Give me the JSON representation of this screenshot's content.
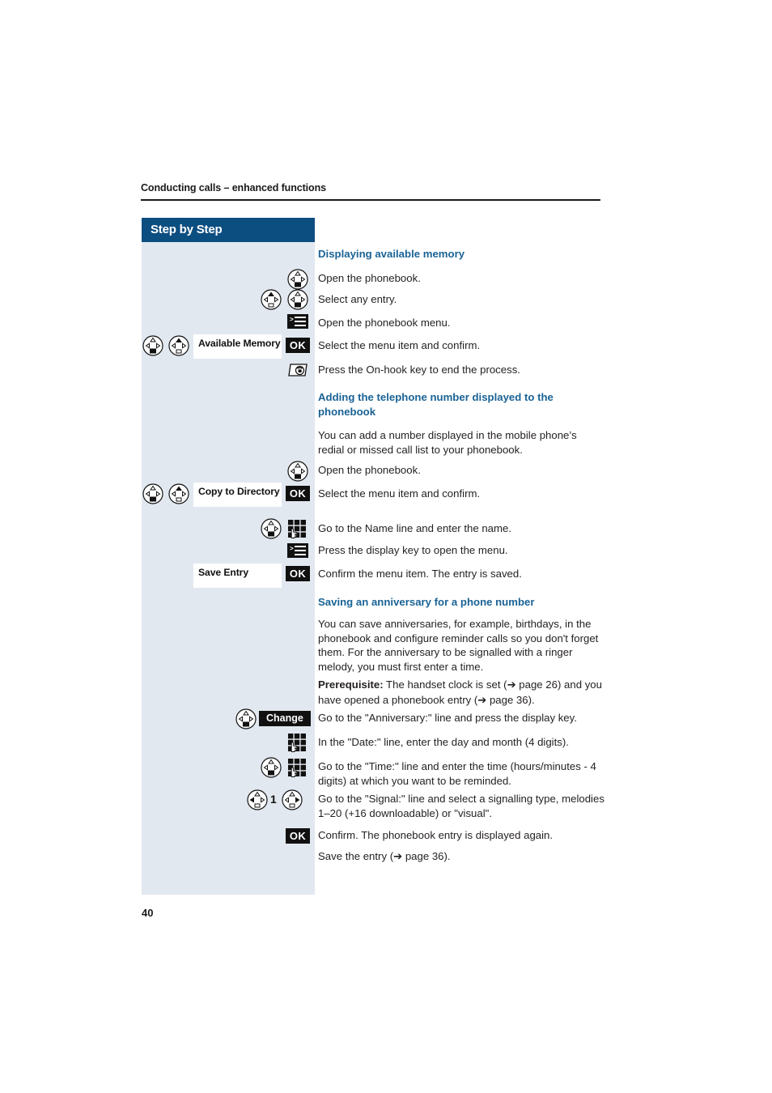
{
  "document": {
    "running_head": "Conducting calls – enhanced functions",
    "page_number": "40",
    "panel_title": "Step by Step"
  },
  "colors": {
    "panel_bg": "#e2e8f0",
    "panel_header_bg": "#0d4e81",
    "heading_blue": "#1a6395",
    "body_text": "#231f20",
    "key_black": "#111111"
  },
  "sections": [
    {
      "id": "displaying-available-memory",
      "heading": "Displaying available memory",
      "steps": [
        {
          "text": "Open the phonebook."
        },
        {
          "text": "Select any entry."
        },
        {
          "text": "Open the phonebook menu."
        },
        {
          "text": "Select the menu item and confirm.",
          "menu_label": "Available Memory"
        },
        {
          "text": "Press the On-hook key to end the process."
        }
      ]
    },
    {
      "id": "adding-the-telephone-number",
      "heading": "Adding the telephone number displayed to the phonebook",
      "intro": "You can add a number displayed in the mobile phone’s redial or missed call list to your phonebook.",
      "steps": [
        {
          "text": "Open the phonebook."
        },
        {
          "text": "Select the menu item and confirm.",
          "menu_label": "Copy to Directory"
        },
        {
          "text": "Go to the Name line and enter the name."
        },
        {
          "text": "Press the display key to open the menu."
        },
        {
          "text": "Confirm the menu item. The entry is saved.",
          "menu_label": "Save Entry"
        }
      ]
    },
    {
      "id": "saving-an-anniversary",
      "heading": "Saving an anniversary for a phone number",
      "intro": "You can save anniversaries, for example, birthdays, in the phonebook and configure reminder calls so you don't forget them. For the anniversary to be signalled with a ringer melody, you must first enter a time.",
      "prerequisite_label": "Prerequisite:",
      "prerequisite_text_1": " The handset clock is set (",
      "prerequisite_ref_1": " page 26",
      "prerequisite_text_2": ") and you have opened a phonebook entry (",
      "prerequisite_ref_2": " page 36",
      "prerequisite_text_3": ").",
      "steps": [
        {
          "text": "Go to the \"Anniversary:\" line and press the display key.",
          "softkey": "Change"
        },
        {
          "text": "In the \"Date:\" line, enter the day and month (4 digits)."
        },
        {
          "text": "Go to the \"Time:\" line and enter the time (hours/minutes - 4 digits) at which you want to be reminded."
        },
        {
          "text": "Go to the \"Signal:\" line and select a signalling type, melodies 1–20 (+16 downloadable) or \"visual\".",
          "digit": "1"
        },
        {
          "text": "Confirm. The phonebook entry is displayed again."
        }
      ],
      "closing_text_1": "Save the entry (",
      "closing_ref": " page 36",
      "closing_text_2": ")."
    }
  ],
  "keys": {
    "ok_label": "OK",
    "arrow_glyph": "➔"
  }
}
